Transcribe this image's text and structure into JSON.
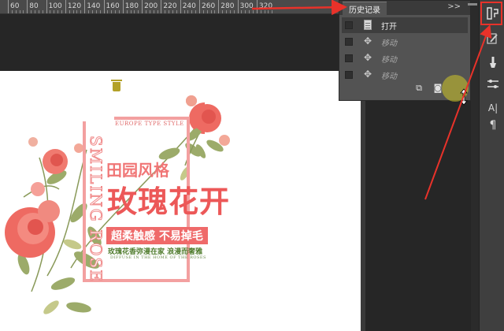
{
  "ruler": {
    "labels": [
      "60",
      "80",
      "100",
      "120",
      "140",
      "160",
      "180",
      "200",
      "220",
      "240",
      "260",
      "280",
      "300",
      "320"
    ]
  },
  "history_panel": {
    "title": "历史记录",
    "collapse_glyph": ">>",
    "items": [
      {
        "label": "打开",
        "icon": "document-icon",
        "active": true
      },
      {
        "label": "移动",
        "icon": "move-icon",
        "active": false
      },
      {
        "label": "移动",
        "icon": "move-icon",
        "active": false
      },
      {
        "label": "移动",
        "icon": "move-icon",
        "active": false
      }
    ],
    "footer_icons": [
      "new-document-from-state-icon",
      "snapshot-camera-icon",
      "trash-icon"
    ]
  },
  "artwork": {
    "europe_text": "EUROPE TYPE STYLE",
    "smiling_text": "SMILING ROSE",
    "sub_title": "田园风格",
    "main_title": "玫瑰花开",
    "banner": "超柔触感 不易掉毛",
    "slogan": "玫瑰花香弥漫在家   浪漫而奢雅",
    "tiny_text": "DIFFUSE IN THE HOME OF THE ROSES"
  },
  "tool_strip": {
    "tools": [
      "history-icon",
      "brush-settings-icon",
      "brush-icon",
      "adjustments-icon",
      "character-icon",
      "paragraph-icon"
    ],
    "glyphs": {
      "character": "A|",
      "paragraph": "¶"
    }
  },
  "colors": {
    "highlight_red": "#e8322a",
    "trash_highlight": "#d2c828",
    "rose_pink": "#ec5858"
  }
}
